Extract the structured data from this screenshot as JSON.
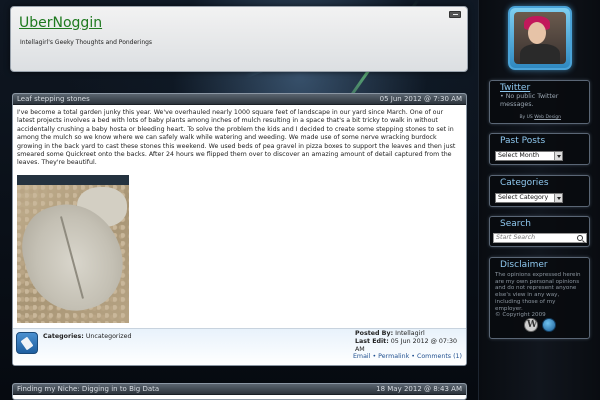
{
  "header": {
    "site_title": "UberNoggin",
    "tagline": "Intellagirl's Geeky Thoughts and Ponderings"
  },
  "posts": [
    {
      "title": "Leaf stepping stones",
      "date": "05 Jun 2012 @ 7:30 AM",
      "body": "I've become a total garden junky this year. We've overhauled nearly 1000 square feet of landscape in our yard since March. One of our latest projects involves a bed with lots of baby plants among inches of mulch resulting in a space that's a bit tricky to walk in without accidentally crushing a baby hosta or bleeding heart. To solve the problem the kids and I decided to create some stepping stones to set in among the mulch so we know where we can safely walk while watering and weeding. We made use of some nerve wracking burdock growing in the back yard to cast these stones this weekend. We used beds of pea gravel in pizza boxes to support the leaves and then just smeared some Quickreet onto the backs. After 24 hours we flipped them over to discover an amazing amount of detail captured from the leaves. They're beautiful.",
      "categories_label": "Categories:",
      "categories_value": "Uncategorized",
      "posted_by_label": "Posted By:",
      "posted_by": "Intellagirl",
      "last_edit_label": "Last Edit:",
      "last_edit": "05 Jun 2012 @ 07:30 AM",
      "links": {
        "email": "Email",
        "sep1": " • ",
        "permalink": "Permalink",
        "sep2": " • ",
        "comments": "Comments (1)"
      }
    },
    {
      "title": "Finding my Niche: Digging in to Big Data",
      "date": "18 May 2012 @ 8:43 AM"
    }
  ],
  "sidebar": {
    "twitter": {
      "title": "Twitter",
      "items": [
        "No public Twitter messages."
      ],
      "byline_prefix": "By US ",
      "byline_link": "Web Design"
    },
    "past_posts": {
      "title": "Past Posts",
      "selected": "Select Month"
    },
    "categories": {
      "title": "Categories",
      "selected": "Select Category"
    },
    "search": {
      "title": "Search",
      "placeholder": "Start Search"
    },
    "disclaimer": {
      "title": "Disclaimer",
      "text": "The opinions expressed herein are my own personal opinions and do not represent anyone else's view in any way, including those of my employer.",
      "copyright": "© Copyright 2009"
    }
  }
}
